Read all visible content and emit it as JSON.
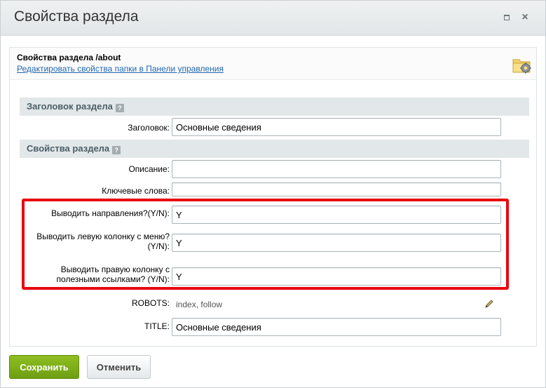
{
  "window": {
    "title": "Свойства раздела",
    "maximize_icon": "maximize-icon",
    "close_icon": "close-icon",
    "close_glyph": "×"
  },
  "info": {
    "title": "Свойства раздела /about",
    "link": "Редактировать свойства папки в Панели управления",
    "icon": "folder-settings-icon"
  },
  "sections": [
    {
      "title": "Заголовок раздела",
      "help": "?"
    },
    {
      "title": "Свойства раздела",
      "help": "?"
    }
  ],
  "fields": {
    "heading": {
      "label": "Заголовок:",
      "value": "Основные сведения"
    },
    "description": {
      "label": "Описание:",
      "value": ""
    },
    "keywords": {
      "label": "Ключевые слова:",
      "value": ""
    },
    "show_directions": {
      "label": "Выводить направления?(Y/N):",
      "value": "Y"
    },
    "show_left_column": {
      "label": "Выводить левую колонку с меню?(Y/N):",
      "value": "Y"
    },
    "show_right_column": {
      "label": "Выводить правую колонку с полезными ссылками? (Y/N):",
      "value": "Y"
    },
    "robots": {
      "label": "ROBOTS:",
      "value": "index, follow",
      "icon": "pencil-icon"
    },
    "title": {
      "label": "TITLE:",
      "value": "Основные сведения"
    }
  },
  "buttons": {
    "save": "Сохранить",
    "cancel": "Отменить"
  },
  "colors": {
    "highlight": "#e8070f",
    "save_button": "#7cae17",
    "link": "#2067b0"
  }
}
